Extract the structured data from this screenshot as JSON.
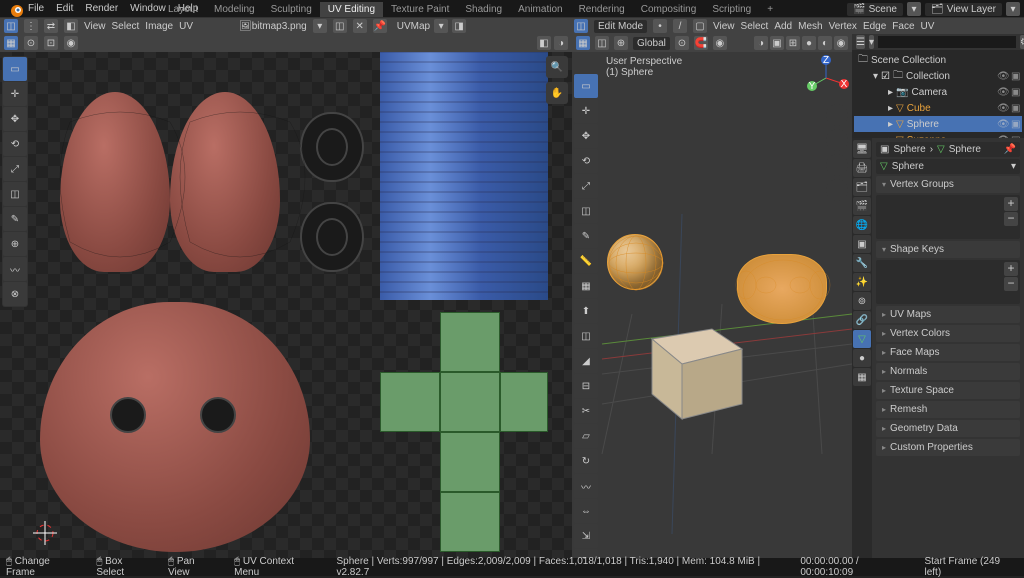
{
  "menu": {
    "items": [
      "File",
      "Edit",
      "Render",
      "Window",
      "Help"
    ]
  },
  "workspaces": {
    "items": [
      "Layout",
      "Modeling",
      "Sculpting",
      "UV Editing",
      "Texture Paint",
      "Shading",
      "Animation",
      "Rendering",
      "Compositing",
      "Scripting"
    ],
    "active": "UV Editing",
    "plus": "+"
  },
  "scene": {
    "label": "Scene",
    "layer": "View Layer"
  },
  "uv_editor": {
    "header_menus": [
      "View",
      "Select",
      "Image",
      "UV"
    ],
    "image_name": "bitmap3.png",
    "uvmap_label": "UVMap"
  },
  "viewport": {
    "mode": "Edit Mode",
    "menus": [
      "View",
      "Select",
      "Add",
      "Mesh",
      "Vertex",
      "Edge",
      "Face",
      "UV"
    ],
    "orientation": "Global",
    "info_line1": "User Perspective",
    "info_line2": "(1) Sphere"
  },
  "outliner": {
    "root": "Scene Collection",
    "collection": "Collection",
    "items": [
      {
        "name": "Camera",
        "color": "#8fbf6f"
      },
      {
        "name": "Cube",
        "color": "#e8a23c"
      },
      {
        "name": "Sphere",
        "color": "#e8a23c",
        "selected": true
      },
      {
        "name": "Suzanne",
        "color": "#e8a23c"
      }
    ]
  },
  "properties": {
    "pin_obj": "Sphere",
    "breadcrumb": "Sphere",
    "obj_name": "Sphere",
    "sections": [
      "Vertex Groups",
      "Shape Keys",
      "UV Maps",
      "Vertex Colors",
      "Face Maps",
      "Normals",
      "Texture Space",
      "Remesh",
      "Geometry Data",
      "Custom Properties"
    ]
  },
  "status": {
    "hints": [
      {
        "icon": "🖱",
        "label": "Change Frame"
      },
      {
        "icon": "🖱",
        "label": "Box Select"
      },
      {
        "icon": "🖱",
        "label": "Pan View"
      },
      {
        "icon": "🖱",
        "label": "UV Context Menu"
      }
    ],
    "stats": "Sphere | Verts:997/997 | Edges:2,009/2,009 | Faces:1,018/1,018 | Tris:1,940 | Mem: 104.8 MiB | v2.82.7",
    "time": "00:00:00.00 / 00:00:10:09",
    "frame": "Start Frame (249 left)"
  }
}
